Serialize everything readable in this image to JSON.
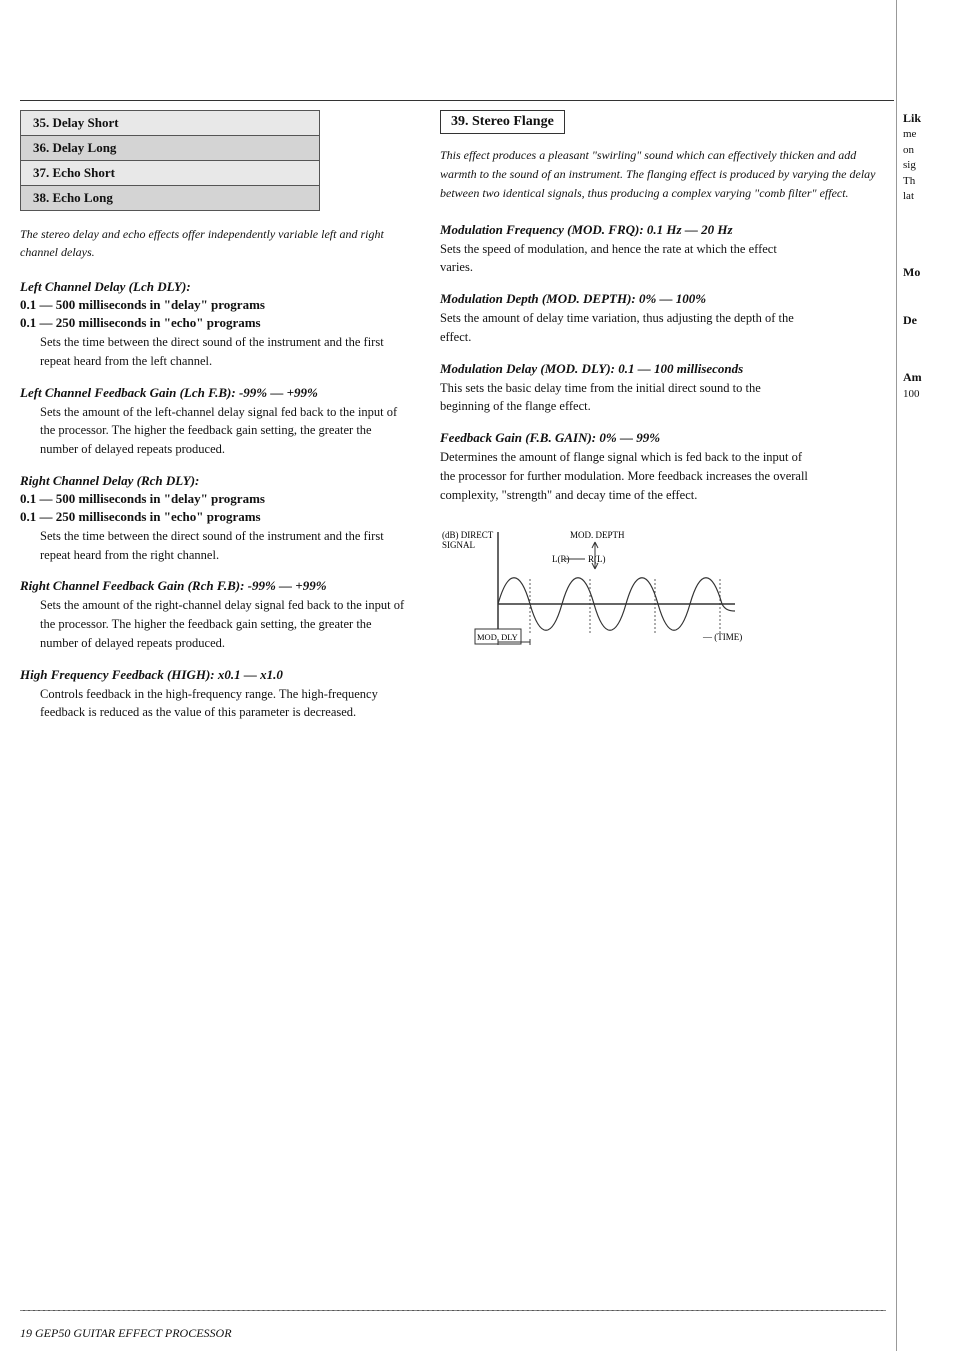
{
  "page": {
    "footer_label": "19   GEP50 GUITAR EFFECT PROCESSOR"
  },
  "left_table": {
    "items": [
      {
        "number": "35.",
        "name": "Delay Short"
      },
      {
        "number": "36.",
        "name": "Delay Long"
      },
      {
        "number": "37.",
        "name": "Echo Short"
      },
      {
        "number": "38.",
        "name": "Echo Long"
      }
    ]
  },
  "left_intro": "The stereo delay and echo effects offer independently variable left and right channel delays.",
  "left_params": [
    {
      "title": "Left Channel Delay (Lch DLY):",
      "sub_lines": [
        "0.1 — 500 milliseconds in \"delay\" programs",
        "0.1 — 250 milliseconds in \"echo\" programs"
      ],
      "desc": "Sets the time between the direct sound of the instrument and the first repeat heard from the left channel."
    },
    {
      "title": "Left Channel Feedback Gain (Lch F.B): -99% — +99%",
      "sub_lines": [],
      "desc": "Sets the amount of the left-channel delay signal fed back to the input of the processor. The higher the feedback gain setting, the greater the number of delayed repeats produced."
    },
    {
      "title": "Right Channel Delay (Rch DLY):",
      "sub_lines": [
        "0.1 — 500 milliseconds in \"delay\" programs",
        "0.1 — 250 milliseconds in \"echo\" programs"
      ],
      "desc": "Sets the time between the direct sound of the instrument and the first repeat heard from the right channel."
    },
    {
      "title": "Right Channel Feedback Gain (Rch F.B): -99% — +99%",
      "sub_lines": [],
      "desc": "Sets the amount of the right-channel delay signal fed back to the input of the processor. The higher the feedback gain setting, the greater the number of delayed repeats produced."
    },
    {
      "title": "High Frequency Feedback (HIGH): x0.1 — x1.0",
      "sub_lines": [],
      "desc": "Controls feedback in the high-frequency range. The high-frequency feedback is reduced as the value of this parameter is decreased."
    }
  ],
  "right_section": {
    "heading": "39.  Stereo Flange",
    "intro": "This effect produces a pleasant \"swirling\" sound which can effectively thicken and add warmth to the sound of an instrument. The flanging effect is produced by varying the delay between two identical signals, thus producing a complex varying \"comb filter\" effect.",
    "params": [
      {
        "title": "Modulation Frequency (MOD. FRQ): 0.1 Hz — 20 Hz",
        "desc": "Sets the speed of modulation, and hence the rate at which the effect varies."
      },
      {
        "title": "Modulation Depth (MOD. DEPTH): 0% — 100%",
        "desc": "Sets the amount of delay time variation, thus adjusting the depth of the effect."
      },
      {
        "title": "Modulation Delay (MOD. DLY): 0.1 — 100 milliseconds",
        "desc": "This sets the basic delay time from the initial direct sound to the beginning of the flange effect."
      },
      {
        "title": "Feedback Gain (F.B. GAIN): 0% — 99%",
        "desc": "Determines the amount of flange signal which is fed back to the input of the processor for further modulation. More feedback increases the overall complexity, \"strength\" and decay time of the effect."
      }
    ]
  },
  "right_sidebar": {
    "blocks": [
      {
        "label": "Lik",
        "lines": [
          "me",
          "on",
          "sig",
          "Th",
          "lat"
        ]
      },
      {
        "label": "Mo",
        "lines": []
      },
      {
        "label": "De",
        "lines": []
      },
      {
        "label": "Am",
        "lines": [
          "100"
        ]
      }
    ]
  },
  "chart": {
    "direct_signal_label": "(dB) DIRECT\nSIGNAL",
    "lr_label": "L(R)",
    "rl_label": "R(L)",
    "mod_depth_label": "MOD. DEPTH",
    "mod_dly_label": "MOD. DLY",
    "time_label": "(TIME)"
  }
}
